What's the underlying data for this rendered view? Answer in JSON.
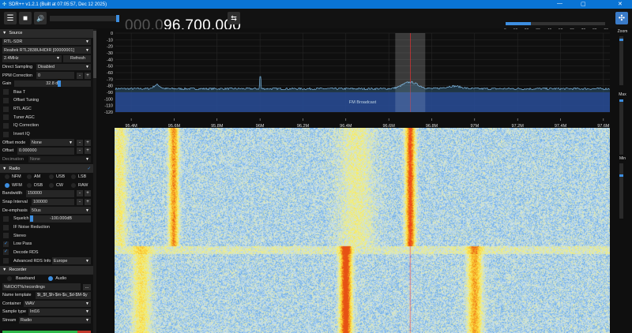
{
  "window": {
    "title": "SDR++ v1.2.1 (Built at 07:05:57, Dec 12 2025)",
    "minimize": "—",
    "maximize": "▢",
    "close": "✕"
  },
  "toolbar": {
    "menu_icon": "☰",
    "stop_icon": "■",
    "volume_icon": "🔊",
    "volume": 1.0,
    "freq_dim": "000.0",
    "freq_bright": "96.700.000",
    "swap_icon": "⇆",
    "snr_ticks": [
      "0",
      "10",
      "20",
      "30",
      "40",
      "50",
      "60",
      "70",
      "80",
      "90"
    ],
    "snr_level": 23
  },
  "source": {
    "header": "Source",
    "device": "RTL-SDR",
    "serial": "Realtek RTL2838UHIDIR [00000001]",
    "samplerate": "2.4MHz",
    "refresh": "Refresh",
    "direct_sampling_label": "Direct Sampling",
    "direct_sampling": "Disabled",
    "ppm_label": "PPM Correction",
    "ppm": "0",
    "gain_label": "Gain",
    "gain": "32.8 dB",
    "checks": [
      {
        "label": "Bias T",
        "on": false
      },
      {
        "label": "Offset Tuning",
        "on": false
      },
      {
        "label": "RTL AGC",
        "on": false
      },
      {
        "label": "Tuner AGC",
        "on": false
      },
      {
        "label": "IQ Correction",
        "on": false
      },
      {
        "label": "Invert IQ",
        "on": false
      }
    ],
    "offset_mode_label": "Offset mode",
    "offset_mode": "None",
    "offset_label": "Offset",
    "offset": "0.000000",
    "decimation_label": "Decimation",
    "decimation": "None"
  },
  "radio": {
    "header": "Radio",
    "modes": [
      "NFM",
      "AM",
      "USB",
      "LSB",
      "WFM",
      "DSB",
      "CW",
      "RAW"
    ],
    "selected": "WFM",
    "bandwidth_label": "Bandwidth",
    "bandwidth": "150000",
    "snap_label": "Snap Interval",
    "snap": "100000",
    "deemph_label": "De-emphasis",
    "deemph": "50us",
    "squelch_label": "Squelch",
    "squelch": "-100.000dB",
    "checks": [
      {
        "label": "IF Noise Reduction",
        "on": false
      },
      {
        "label": "Stereo",
        "on": false
      },
      {
        "label": "Low Pass",
        "on": true
      },
      {
        "label": "Decode RDS",
        "on": true
      }
    ],
    "rds_label": "Advanced RDS Info",
    "rds": "Europe"
  },
  "recorder": {
    "header": "Recorder",
    "baseband": "Baseband",
    "audio": "Audio",
    "path": "%ROOT%/recordings",
    "browse": "...",
    "name_label": "Name template",
    "name": "$t_$f_$h-$m-$s_$d-$M-$y",
    "container_label": "Container",
    "container": "WAV",
    "sample_label": "Sample type",
    "sample": "Int16",
    "stream_label": "Stream",
    "stream": "Radio"
  },
  "spectrum": {
    "db_ticks": [
      "0",
      "-10",
      "-20",
      "-30",
      "-40",
      "-50",
      "-60",
      "-70",
      "-80",
      "-90",
      "-100",
      "-110",
      "-120"
    ],
    "freq_ticks": [
      "95.4M",
      "95.6M",
      "95.8M",
      "96M",
      "96.2M",
      "96.4M",
      "96.6M",
      "96.8M",
      "97M",
      "97.2M",
      "97.4M",
      "97.6M"
    ],
    "band_label": "FM Broadcast",
    "vfo_mhz": 96.7
  },
  "right": {
    "zoom": "Zoom",
    "max": "Max",
    "min": "Min"
  }
}
